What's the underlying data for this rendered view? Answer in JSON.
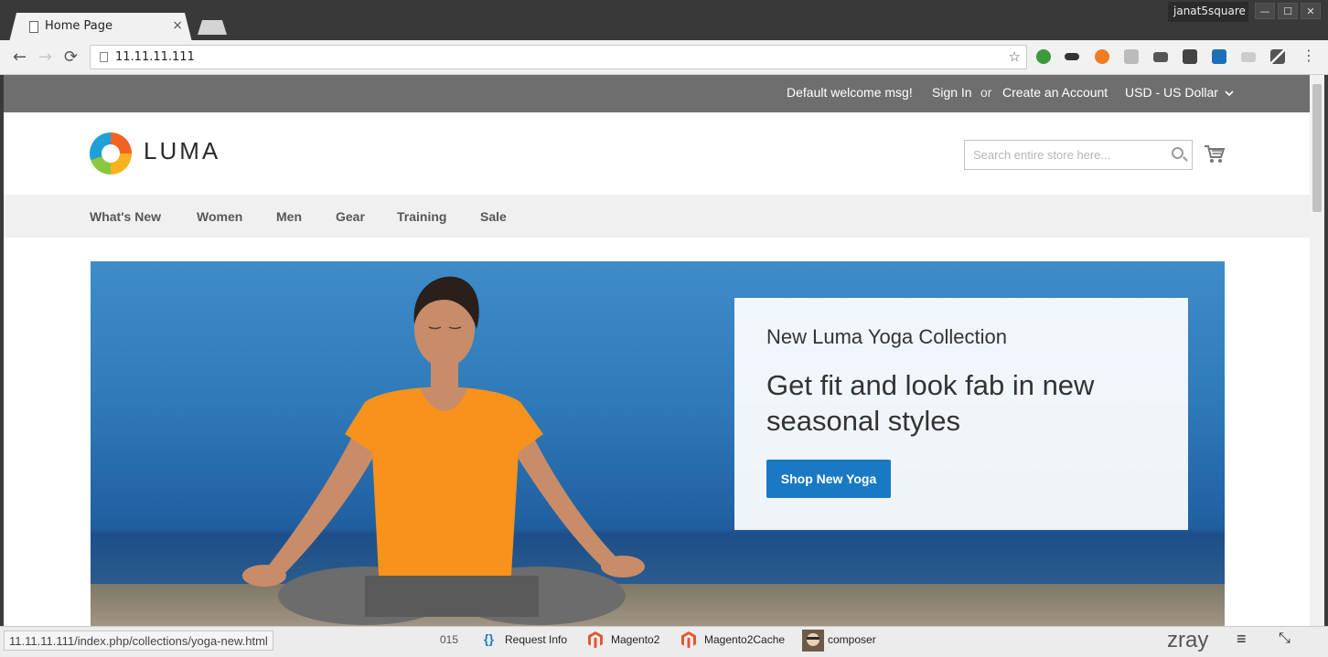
{
  "browser": {
    "tab_title": "Home Page",
    "tab_close": "×",
    "profile": "janat5square",
    "window_buttons": [
      "—",
      "☐",
      "✕"
    ],
    "url": "11.11.11.111",
    "back": "←",
    "forward": "→",
    "reload": "⟳",
    "bookmark_star": "☆",
    "menu": "⋮"
  },
  "panel": {
    "welcome": "Default welcome msg!",
    "sign_in": "Sign In",
    "or": "or",
    "create_account": "Create an Account",
    "currency": "USD - US Dollar"
  },
  "header": {
    "logo_text": "LUMA",
    "search_placeholder": "Search entire store here..."
  },
  "nav": {
    "items": [
      "What's New",
      "Women",
      "Men",
      "Gear",
      "Training",
      "Sale"
    ]
  },
  "hero": {
    "subtitle": "New Luma Yoga Collection",
    "title": "Get fit and look fab in new seasonal styles",
    "button": "Shop New Yoga"
  },
  "status": {
    "hover_url": "11.11.11.111/index.php/collections/yoga-new.html"
  },
  "zray": {
    "partial": "015",
    "items": [
      "Request Info",
      "Magento2",
      "Magento2Cache",
      "composer"
    ],
    "logo": "zray",
    "menu": "≡",
    "collapse": "⤡"
  }
}
